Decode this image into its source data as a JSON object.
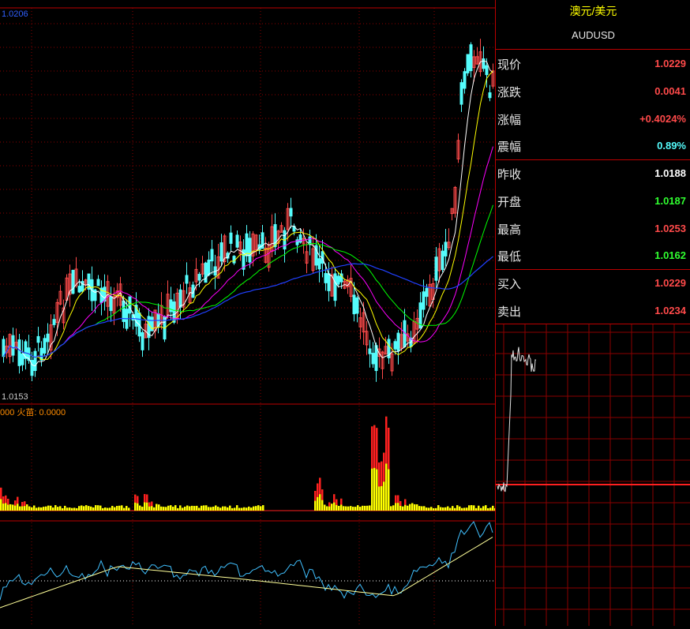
{
  "colors": {
    "up": "#ff4a4a",
    "down": "#54fcfc",
    "grid": "#8b0000",
    "ma5": "#ffffff",
    "ma10": "#ffff00",
    "ma20": "#ff00ff",
    "ma30": "#00ff00",
    "ma60": "#2040ff",
    "fire_red": "#ff2020",
    "fire_yellow": "#ffff00",
    "indicator_line": "#ffff99"
  },
  "chart": {
    "high_label": "1.0206",
    "low_label": "1.0153",
    "indicator_label": "000  火苗: 0.0000"
  },
  "quote": {
    "title_cn": "澳元/美元",
    "symbol": "AUDUSD",
    "rows": [
      {
        "label": "现价",
        "value": "1.0229",
        "color": "#ff4a4a"
      },
      {
        "label": "涨跌",
        "value": "0.0041",
        "color": "#ff4a4a"
      },
      {
        "label": "涨幅",
        "value": "+0.4024%",
        "color": "#ff4a4a"
      },
      {
        "label": "震幅",
        "value": "0.89%",
        "color": "#54fcfc"
      },
      {
        "label": "昨收",
        "value": "1.0188",
        "color": "#ffffff"
      },
      {
        "label": "开盘",
        "value": "1.0187",
        "color": "#30ff30"
      },
      {
        "label": "最高",
        "value": "1.0253",
        "color": "#ff4a4a"
      },
      {
        "label": "最低",
        "value": "1.0162",
        "color": "#30ff30"
      },
      {
        "label": "买入",
        "value": "1.0229",
        "color": "#ff4a4a"
      },
      {
        "label": "卖出",
        "value": "1.0234",
        "color": "#ff4a4a"
      }
    ]
  }
}
